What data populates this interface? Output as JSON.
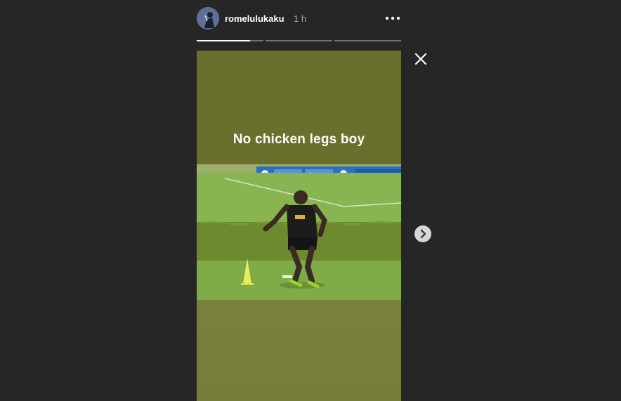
{
  "story": {
    "username": "romelulukaku",
    "time_ago": "1 h",
    "caption": "No chicken legs boy",
    "progress_segments": [
      0.8,
      0.0,
      0.0
    ],
    "photo_banner_texts": [
      "Lenovo",
      "Lenovo"
    ]
  },
  "icons": {
    "more": "more-horizontal-icon",
    "close": "close-icon",
    "next": "chevron-right-icon"
  },
  "colors": {
    "background": "#262626",
    "card_green": "#6b6f2e"
  }
}
